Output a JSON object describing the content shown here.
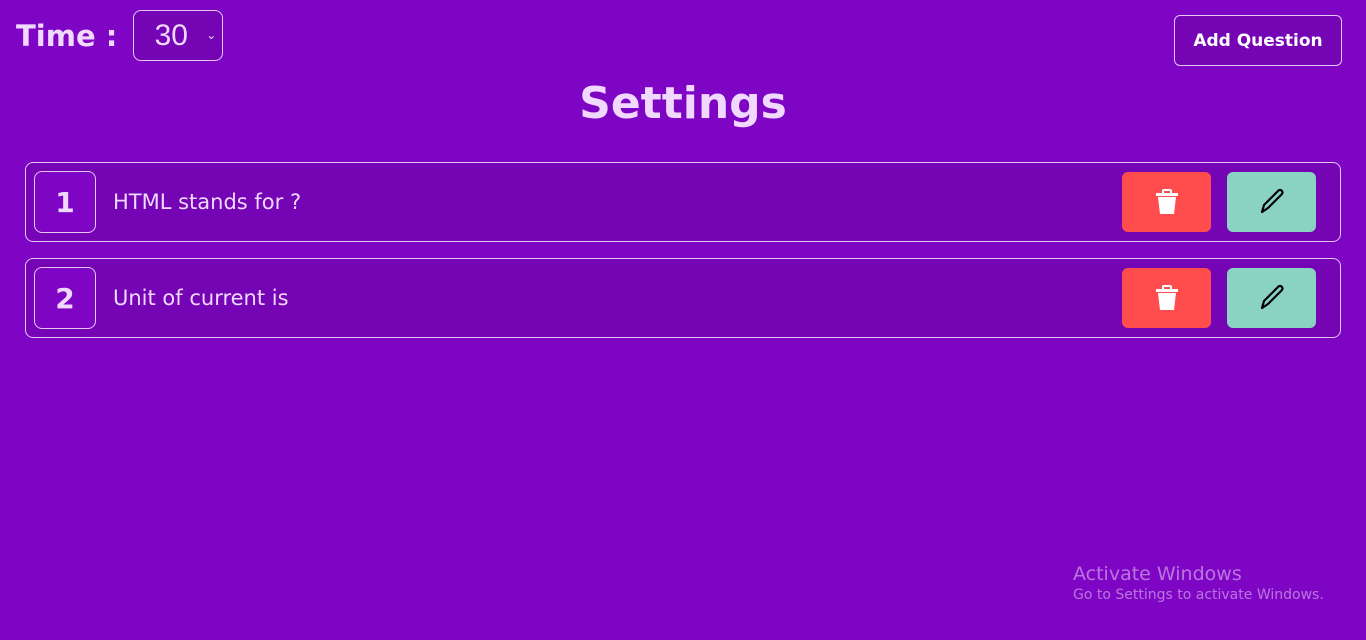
{
  "header": {
    "time_label": "Time :",
    "time_value": "30",
    "add_label": "Add Question",
    "title": "Settings"
  },
  "questions": [
    {
      "number": "1",
      "text": "HTML stands for ?"
    },
    {
      "number": "2",
      "text": "Unit of current is"
    }
  ],
  "icons": {
    "delete": "trash-icon",
    "edit": "pencil-icon"
  },
  "colors": {
    "background": "#7f05c4",
    "delete": "#ff4d4d",
    "edit": "#8ad2c2"
  },
  "watermark": {
    "title": "Activate Windows",
    "subtitle": "Go to Settings to activate Windows."
  }
}
